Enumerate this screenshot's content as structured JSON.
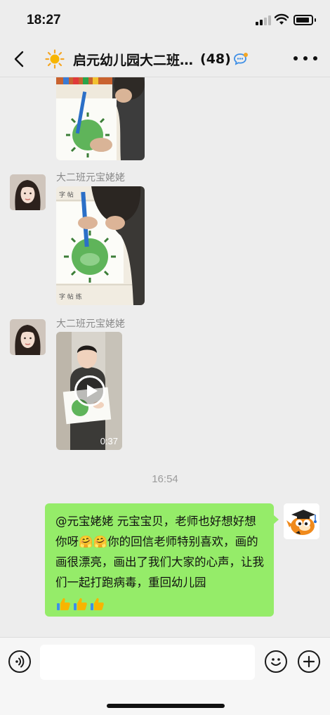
{
  "status_bar": {
    "time": "18:27"
  },
  "header": {
    "group_name": "启元幼儿园大二班…",
    "member_count": "(48)",
    "icons": [
      "back-arrow-icon",
      "sun-icon",
      "group-chat-icon",
      "more-icon"
    ]
  },
  "messages": [
    {
      "type": "image",
      "sender": "",
      "description_icon": "drawing-photo"
    },
    {
      "type": "image",
      "sender": "大二班元宝姥姥"
    },
    {
      "type": "video",
      "sender": "大二班元宝姥姥",
      "duration": "0:37"
    },
    {
      "type": "time",
      "text": "16:54"
    },
    {
      "type": "text",
      "from_me": true,
      "text": "@元宝姥姥 元宝宝贝，老师也好想好想你呀🤗🤗你的回信老师特别喜欢，画的画很漂亮，画出了我们大家的心声，让我们一起打跑病毒，重回幼儿园",
      "reactions": "👍👍👍"
    }
  ],
  "input_bar": {
    "placeholder": "",
    "icons": [
      "voice-icon",
      "emoji-icon",
      "plus-icon"
    ]
  },
  "colors": {
    "background": "#ededed",
    "my_bubble": "#95ec69",
    "input_bar": "#f6f6f6"
  }
}
